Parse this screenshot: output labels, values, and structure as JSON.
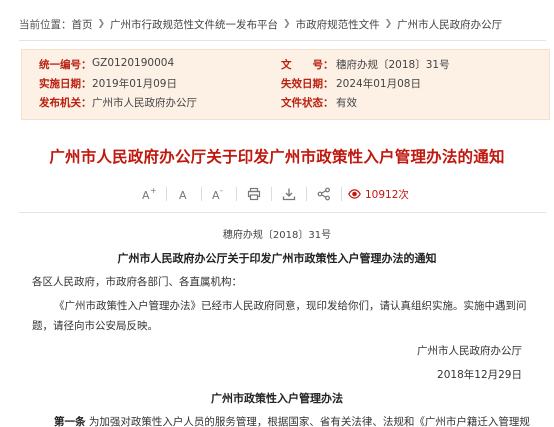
{
  "breadcrumb": {
    "prefix": "当前位置：",
    "items": [
      "首页",
      "广州市行政规范性文件统一发布平台",
      "市政府规范性文件",
      "广州市人民政府办公厅"
    ],
    "separator": "❯"
  },
  "meta": {
    "serial_label": "统一编号：",
    "serial_value": "GZ0120190004",
    "docno_label": "文　　号：",
    "docno_value": "穗府办规〔2018〕31号",
    "effective_label": "实施日期：",
    "effective_value": "2019年01月09日",
    "expiry_label": "失效日期：",
    "expiry_value": "2024年01月08日",
    "issuer_label": "发布机关：",
    "issuer_value": "广州市人民政府办公厅",
    "status_label": "文件状态：",
    "status_value": "有效"
  },
  "title": "广州市人民政府办公厅关于印发广州市政策性入户管理办法的通知",
  "toolbar": {
    "font_increase": "A+",
    "font_reset": "A",
    "font_decrease": "A-",
    "view_count": "10912次"
  },
  "body": {
    "doc_number": "穗府办规〔2018〕31号",
    "notice_title": "广州市人民政府办公厅关于印发广州市政策性入户管理办法的通知",
    "addressee": "各区人民政府，市政府各部门、各直属机构：",
    "para_line1": "《广州市政策性入户管理办法》已经市人民政府同意，现印发给你们，请认真组织实施。实施中遇到问",
    "para_line2": "题，请径向市公安局反映。",
    "signature": "广州市人民政府办公厅",
    "date": "2018年12月29日",
    "section_title": "广州市政策性入户管理办法",
    "article1_label": "第一条",
    "article1_text": "为加强对政策性入户人员的服务管理，根据国家、省有关法律、法规和《广州市户籍迁入管理规"
  },
  "colors": {
    "accent_red": "#c0170e",
    "meta_bg": "#fdf1e6"
  }
}
